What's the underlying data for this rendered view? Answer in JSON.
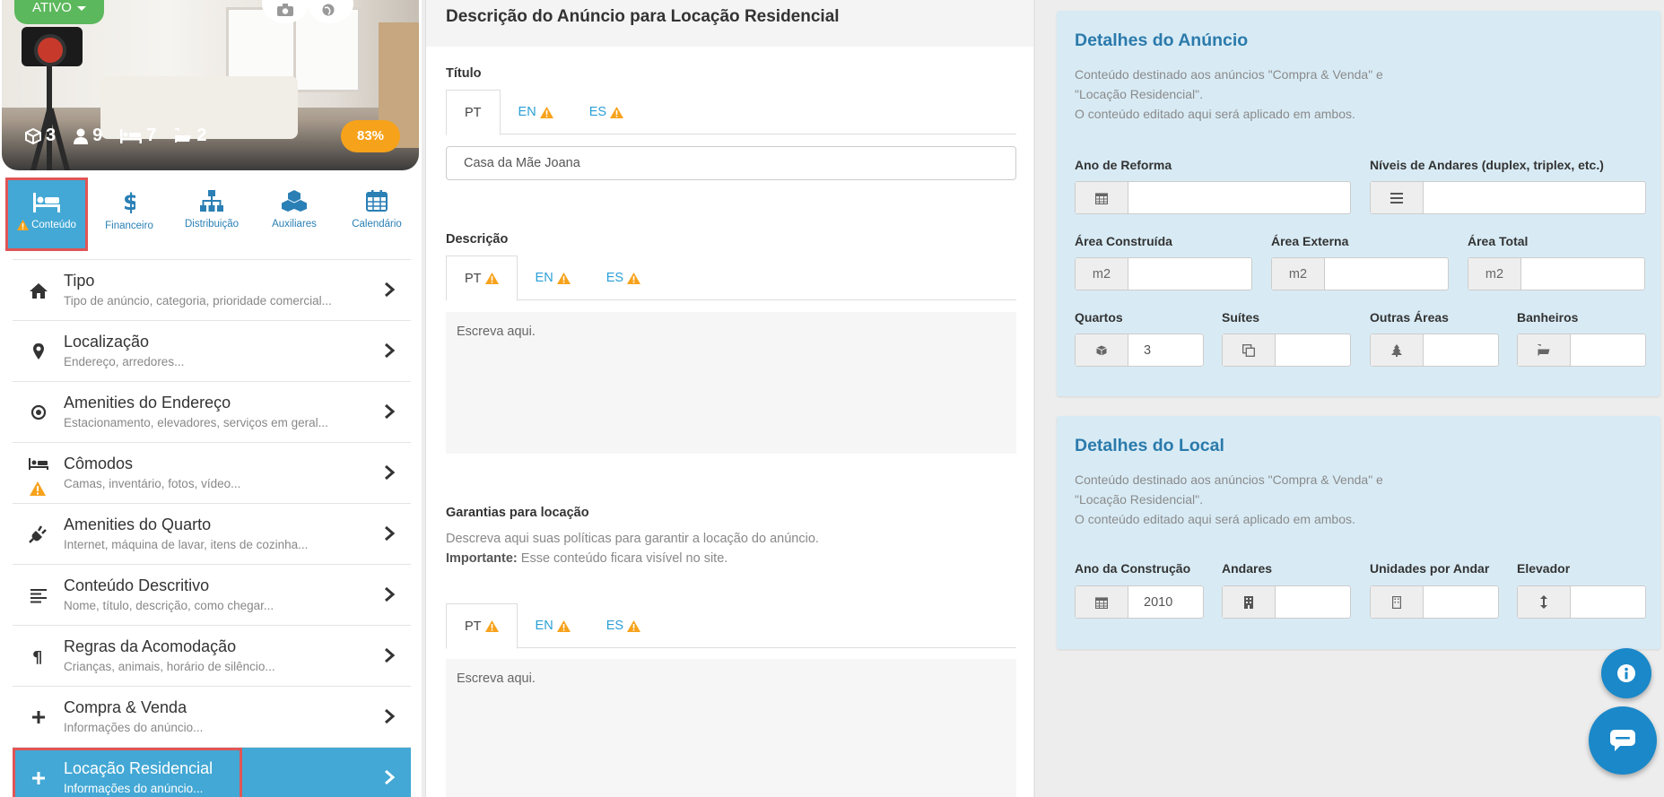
{
  "listing": {
    "status_label": "ATIVO",
    "stats": {
      "rooms": "3",
      "guests": "9",
      "beds": "7",
      "baths": "2"
    },
    "completeness": "83%"
  },
  "nav_tabs": [
    {
      "label": "Conteúdo",
      "icon": "bed-icon"
    },
    {
      "label": "Financeiro",
      "icon": "dollar-icon"
    },
    {
      "label": "Distribuição",
      "icon": "sitemap-icon"
    },
    {
      "label": "Auxiliares",
      "icon": "cubes-icon"
    },
    {
      "label": "Calendário",
      "icon": "calendar-icon"
    }
  ],
  "menu": [
    {
      "title": "Tipo",
      "subtitle": "Tipo de anúncio, categoria, prioridade comercial...",
      "icon": "home-icon"
    },
    {
      "title": "Localização",
      "subtitle": "Endereço, arredores...",
      "icon": "map-pin-icon"
    },
    {
      "title": "Amenities do Endereço",
      "subtitle": "Estacionamento, elevadores, serviços em geral...",
      "icon": "target-icon"
    },
    {
      "title": "Cômodos",
      "subtitle": "Camas, inventário, fotos, vídeo...",
      "icon": "bed-icon"
    },
    {
      "title": "Amenities do Quarto",
      "subtitle": "Internet, máquina de lavar, itens de cozinha...",
      "icon": "plug-icon"
    },
    {
      "title": "Conteúdo Descritivo",
      "subtitle": "Nome, título, descrição, como chegar...",
      "icon": "align-left-icon"
    },
    {
      "title": "Regras da Acomodação",
      "subtitle": "Crianças, animais, horário de silêncio...",
      "icon": "paragraph-icon"
    },
    {
      "title": "Compra & Venda",
      "subtitle": "Informações do anúncio...",
      "icon": "plus-icon"
    },
    {
      "title": "Locação Residencial",
      "subtitle": "Informações do anúncio...",
      "icon": "plus-icon"
    }
  ],
  "middle": {
    "heading": "Descrição do Anúncio para Locação Residencial",
    "title_label": "Título",
    "title_tabs": [
      "PT",
      "EN",
      "ES"
    ],
    "title_value": "Casa da Mãe Joana",
    "description_label": "Descrição",
    "description_tabs": [
      "PT",
      "EN",
      "ES"
    ],
    "description_placeholder": "Escreva aqui.",
    "guarantees_label": "Garantias para locação",
    "guarantees_help": "Descreva aqui suas políticas para garantir a locação do anúncio.",
    "guarantees_important_label": "Importante:",
    "guarantees_important_text": " Esse conteúdo ficara visível no site.",
    "guarantees_tabs": [
      "PT",
      "EN",
      "ES"
    ],
    "guarantees_placeholder": "Escreva aqui."
  },
  "ad_details": {
    "title": "Detalhes do Anúncio",
    "desc_line1": "Conteúdo destinado aos anúncios \"Compra & Venda\" e",
    "desc_line2": "\"Locação Residencial\".",
    "desc_line3": "O conteúdo editado aqui será aplicado em ambos.",
    "renovation_year_label": "Ano de Reforma",
    "renovation_year_value": "",
    "floor_levels_label": "Níveis de Andares (duplex, triplex, etc.)",
    "floor_levels_value": "",
    "built_area_label": "Área Construída",
    "external_area_label": "Área Externa",
    "total_area_label": "Área Total",
    "area_unit": "m2",
    "bedrooms_label": "Quartos",
    "bedrooms_value": "3",
    "suites_label": "Suítes",
    "suites_value": "",
    "other_areas_label": "Outras Áreas",
    "other_areas_value": "",
    "bathrooms_label": "Banheiros",
    "bathrooms_value": ""
  },
  "place_details": {
    "title": "Detalhes do Local",
    "desc_line1": "Conteúdo destinado aos anúncios \"Compra & Venda\" e",
    "desc_line2": "\"Locação Residencial\".",
    "desc_line3": "O conteúdo editado aqui será aplicado em ambos.",
    "construction_year_label": "Ano da Construção",
    "construction_year_value": "2010",
    "floors_label": "Andares",
    "floors_value": "",
    "units_per_floor_label": "Unidades por Andar",
    "units_per_floor_value": "",
    "elevator_label": "Elevador",
    "elevator_value": ""
  },
  "colors": {
    "accent": "#43a8d5",
    "link": "#2a9fd6",
    "status_green": "#5cb85c",
    "warning": "#f7a21b",
    "highlight_border": "#e05555",
    "card_bg": "#d8ebf5",
    "fab_blue": "#1a88c9"
  }
}
